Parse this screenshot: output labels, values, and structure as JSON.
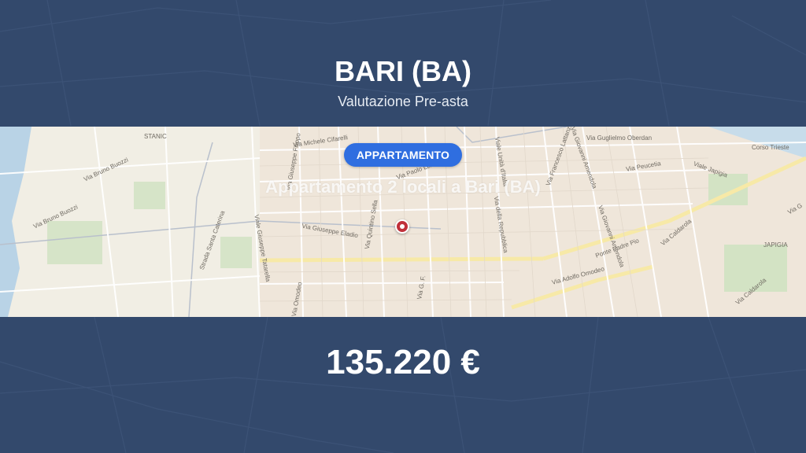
{
  "header": {
    "title": "BARI (BA)",
    "subtitle": "Valutazione Pre-asta"
  },
  "map": {
    "badge": "APPARTAMENTO",
    "listing_title": "Appartamento 2 locali a Bari (BA)",
    "labels": {
      "stanic": "STANIC",
      "via_bruno_buozzi_1": "Via Bruno Buozzi",
      "via_bruno_buozzi_2": "Via Bruno Buozzi",
      "via_michele_cifarelli": "Via Michele Cifarelli",
      "via_giuseppe_filippo": "Via Giuseppe Filippo",
      "via_paolo_lembo": "Via Paolo Lembo",
      "viale_unita_italia": "Viale Unità d'Italia",
      "via_francesco_lattanzio": "Via Francesco Lattanzio",
      "via_giovanni_amendola_1": "Via Giovanni Amendola",
      "via_giovanni_amendola_2": "Via Giovanni Amendola",
      "via_guglielmo_oberdan": "Via Guglielmo Oberdan",
      "corso_trieste": "Corso Trieste",
      "via_peucetia": "Via Peucetia",
      "viale_japigia": "Viale Japigia",
      "via_g": "Via G",
      "via_giuseppe_tatarella": "Viale Giuseppe Tatarella",
      "via_giuseppe_suppa": "Via Giuseppe Suppa",
      "via_giuseppe_eladio": "Via Giuseppe Eladio",
      "via_quintino_sella": "Via Quintino Sella",
      "via_della_repubblica": "Via della Repubblica",
      "viale_giovanni_gentile": "Viale Giovanni Gentile",
      "via_omodeo": "Via Omodeo",
      "via_adolfo_omodeo": "Via Adolfo Omodeo",
      "ponte_padre_pio": "Ponte Padre Pio",
      "via_caldarola_1": "Via Caldarola",
      "via_caldarola_2": "Via Caldarola",
      "japigia": "JAPIGIA",
      "strada_santa_caterina": "Strada Santa Caterina",
      "via_gf": "Via G. F."
    }
  },
  "footer": {
    "price": "135.220 €"
  },
  "colors": {
    "background": "#33496c",
    "badge": "#2f6ee0",
    "pin": "#c0303a"
  },
  "icons": {
    "pin": "map-pin-icon"
  }
}
